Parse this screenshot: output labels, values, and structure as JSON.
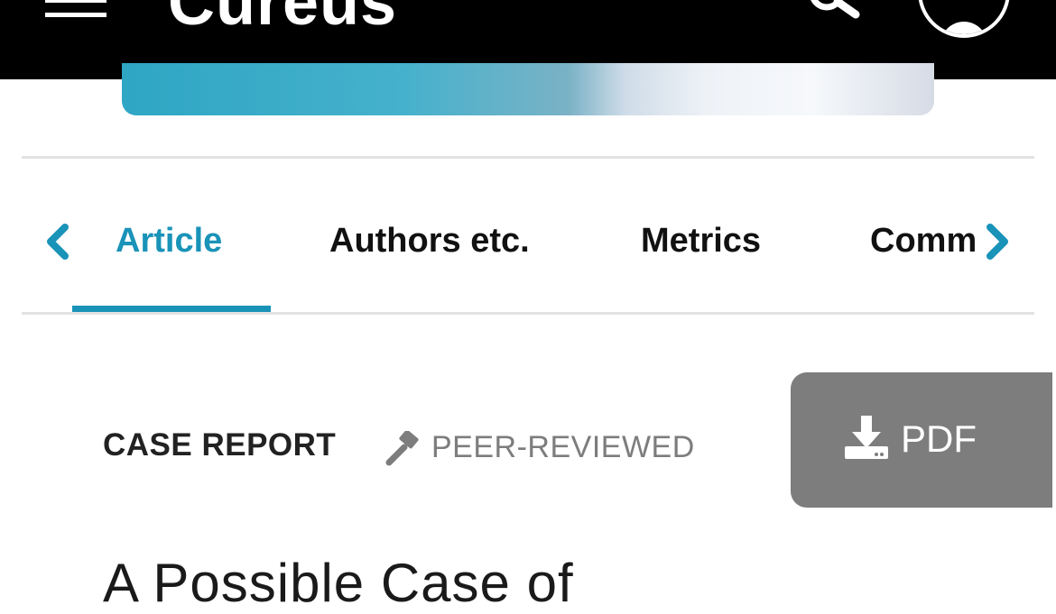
{
  "header": {
    "logo_text": "Cureus",
    "menu_icon": "hamburger-menu-icon",
    "search_icon": "search-icon",
    "account_icon": "user-avatar-icon"
  },
  "tabs": {
    "items": [
      {
        "label": "Article",
        "active": true
      },
      {
        "label": "Authors etc.",
        "active": false
      },
      {
        "label": "Metrics",
        "active": false
      },
      {
        "label": "Comm",
        "active": false
      }
    ],
    "prev_icon": "chevron-left-icon",
    "next_icon": "chevron-right-icon"
  },
  "article": {
    "type_label": "CASE REPORT",
    "review_label": "PEER-REVIEWED",
    "review_icon": "gavel-icon",
    "pdf_label": "PDF",
    "pdf_icon": "download-icon",
    "title": "A Possible Case of"
  },
  "colors": {
    "accent": "#1a93b8",
    "header_bg": "#000000",
    "pdf_button_bg": "#7d7d7d"
  }
}
